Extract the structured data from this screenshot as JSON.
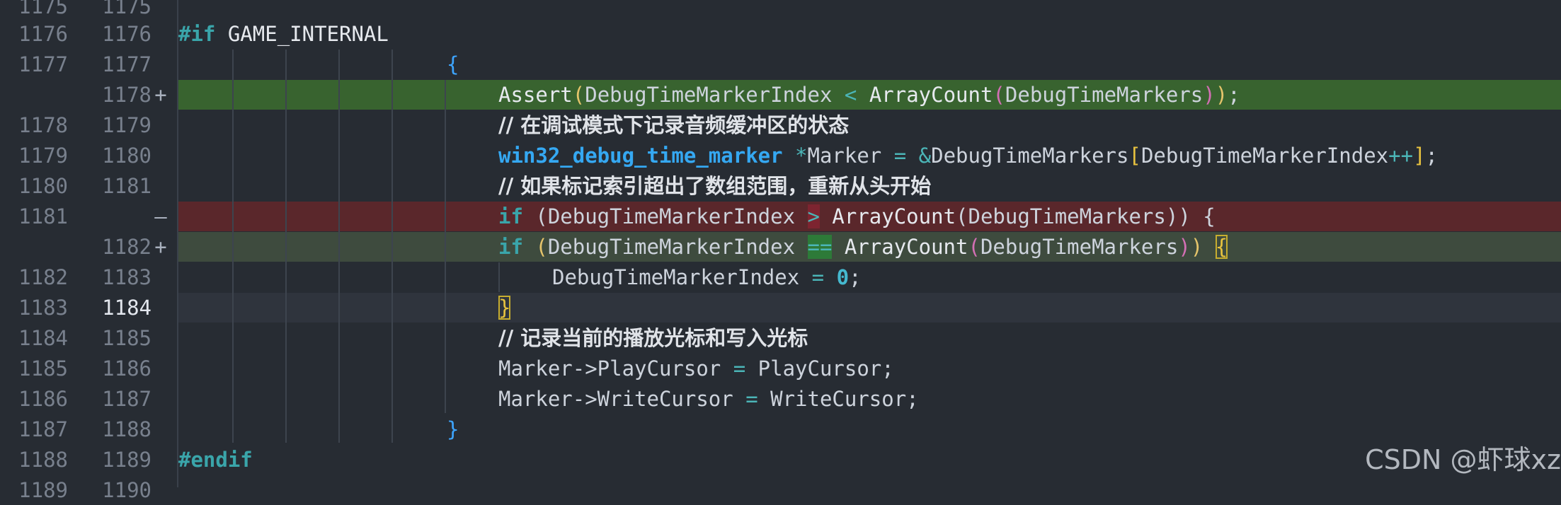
{
  "lines": [
    {
      "old": "1175",
      "new": "1175",
      "marker": ""
    },
    {
      "old": "1176",
      "new": "1176",
      "marker": ""
    },
    {
      "old": "1177",
      "new": "1177",
      "marker": ""
    },
    {
      "old": "",
      "new": "1178",
      "marker": "+"
    },
    {
      "old": "1178",
      "new": "1179",
      "marker": ""
    },
    {
      "old": "1179",
      "new": "1180",
      "marker": ""
    },
    {
      "old": "1180",
      "new": "1181",
      "marker": ""
    },
    {
      "old": "1181",
      "new": "",
      "marker": "—"
    },
    {
      "old": "",
      "new": "1182",
      "marker": "+"
    },
    {
      "old": "1182",
      "new": "1183",
      "marker": ""
    },
    {
      "old": "1183",
      "new": "1184",
      "marker": ""
    },
    {
      "old": "1184",
      "new": "1185",
      "marker": ""
    },
    {
      "old": "1185",
      "new": "1186",
      "marker": ""
    },
    {
      "old": "1186",
      "new": "1187",
      "marker": ""
    },
    {
      "old": "1187",
      "new": "1188",
      "marker": ""
    },
    {
      "old": "1188",
      "new": "1189",
      "marker": ""
    },
    {
      "old": "1189",
      "new": "1190",
      "marker": ""
    }
  ],
  "code": {
    "l1176": {
      "directive": "#if",
      "symbol": " GAME_INTERNAL"
    },
    "l1177": {
      "brace": "{"
    },
    "l1178": {
      "func": "Assert",
      "p_open": "(",
      "a1": "DebugTimeMarkerIndex",
      "op": " < ",
      "f2": "ArrayCount",
      "p2_open": "(",
      "a2": "DebugTimeMarkers",
      "p2_close": ")",
      "p_close": ")",
      "end": ";"
    },
    "l1179": {
      "comment": "// 在调试模式下记录音频缓冲区的状态"
    },
    "l1180": {
      "type": "win32_debug_time_marker",
      "op1": " *",
      "var": "Marker",
      "op2": " = &",
      "arr": "DebugTimeMarkers",
      "b_open": "[",
      "idx": "DebugTimeMarkerIndex",
      "incr": "++",
      "b_close": "]",
      "end": ";"
    },
    "l1181": {
      "comment": "// 如果标记索引超出了数组范围，重新从头开始"
    },
    "l_removed": {
      "kw": "if",
      "p_open": " (",
      "a1": "DebugTimeMarkerIndex ",
      "op": ">",
      "f2": " ArrayCount",
      "p2_open": "(",
      "a2": "DebugTimeMarkers",
      "tail": ")) {"
    },
    "l1182": {
      "kw": "if",
      "p_open": " (",
      "a1": "DebugTimeMarkerIndex ",
      "op": "==",
      "f2": " ArrayCount",
      "p2_open": "(",
      "a2": "DebugTimeMarkers",
      "p2_close": ")",
      "p_close": ")",
      "brace": "{"
    },
    "l1183": {
      "var": "DebugTimeMarkerIndex",
      "op": " = ",
      "num": "0",
      "end": ";"
    },
    "l1184": {
      "brace": "}"
    },
    "l1185": {
      "comment": "// 记录当前的播放光标和写入光标"
    },
    "l1186": {
      "lhs": "Marker->PlayCursor",
      "op": " = ",
      "rhs": "PlayCursor",
      "end": ";"
    },
    "l1187": {
      "lhs": "Marker->WriteCursor",
      "op": " = ",
      "rhs": "WriteCursor",
      "end": ";"
    },
    "l1188": {
      "brace": "}"
    },
    "l1189": {
      "directive": "#endif"
    }
  },
  "watermark": "CSDN @虾球xz",
  "colors": {
    "background": "#272c33",
    "added": "#38632f",
    "removed": "#5a272b",
    "modified": "#3e4b3e",
    "keyword": "#3aa5aa",
    "type": "#35a8f2"
  }
}
